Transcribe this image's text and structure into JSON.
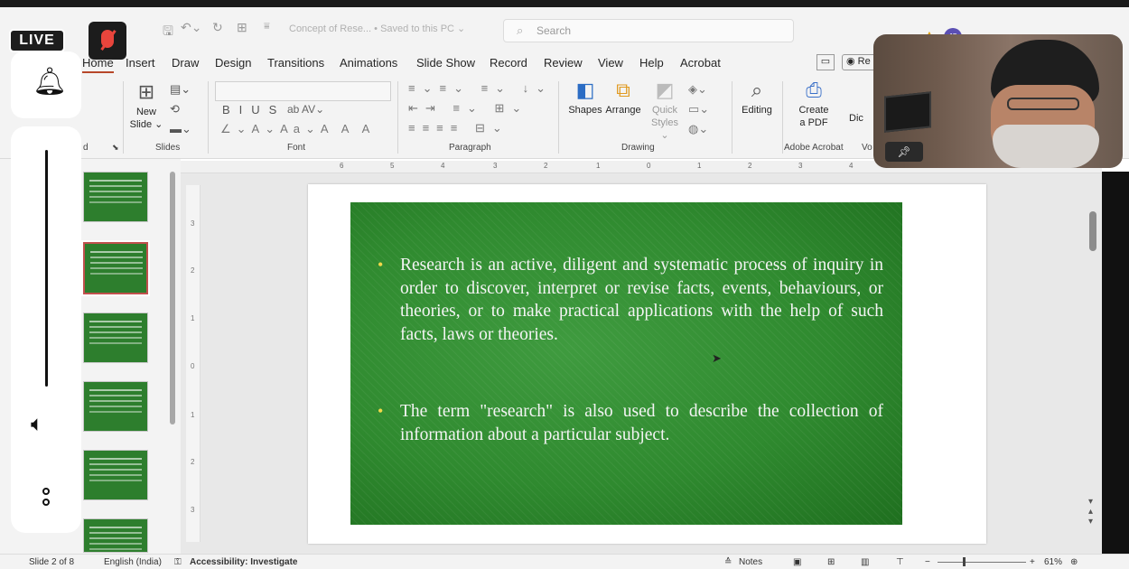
{
  "titlebar": {
    "doc_title": "Concept of Rese... • Saved to this PC ⌄",
    "search_placeholder": "Search",
    "user_initials": "JS"
  },
  "ribbon_tabs": [
    "Home",
    "Insert",
    "Draw",
    "Design",
    "Transitions",
    "Animations",
    "Slide Show",
    "Record",
    "Review",
    "View",
    "Help",
    "Acrobat"
  ],
  "ribbon": {
    "slides_group": {
      "new_slide": "New\nSlide ⌄",
      "label": "Slides"
    },
    "clipboard_label_tail": "d",
    "font_label": "Font",
    "paragraph_label": "Paragraph",
    "drawing": {
      "shapes": "Shapes",
      "arrange": "Arrange",
      "quick_styles": "Quick\nStyles ⌄",
      "label": "Drawing"
    },
    "editing": "Editing",
    "acrobat": {
      "create_pdf": "Create\na PDF",
      "label": "Adobe Acrobat"
    },
    "dictate_partial": "Dic",
    "voice_partial": "Vo",
    "record_partial": "Re"
  },
  "ruler_marks": [
    "6",
    "5",
    "4",
    "3",
    "2",
    "1",
    "0",
    "1",
    "2",
    "3",
    "4"
  ],
  "vruler_marks": [
    "3",
    "2",
    "1",
    "0",
    "1",
    "2",
    "3"
  ],
  "slide": {
    "bullets": [
      "Research is an active, diligent and systematic process of inquiry in order to discover, interpret or revise facts, events, behaviours, or theories, or to make practical applications with the help of such facts, laws or theories.",
      "The term \"research\" is also used to describe the collection of information about a particular subject."
    ]
  },
  "thumbnails": {
    "selected_index": 1
  },
  "statusbar": {
    "slide_pos": "Slide 2 of 8",
    "language": "English (India)",
    "accessibility": "Accessibility: Investigate",
    "notes": "Notes",
    "zoom": "61%"
  },
  "overlay": {
    "live_label": "LIVE"
  }
}
